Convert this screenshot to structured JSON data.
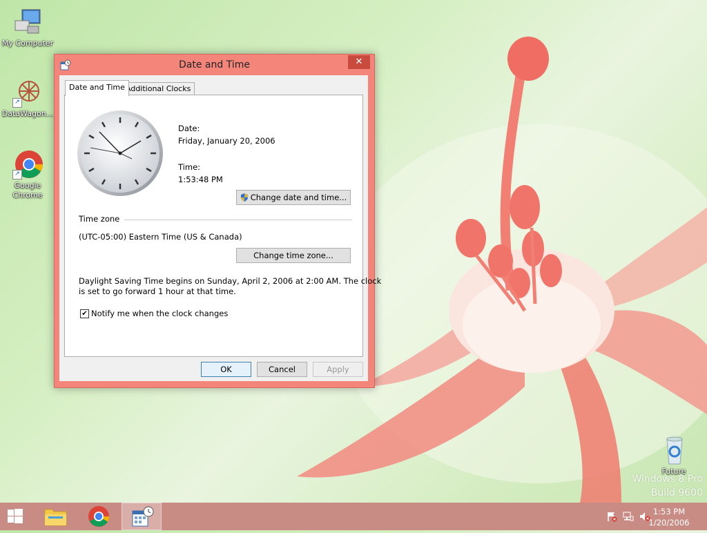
{
  "desktop": {
    "icons": [
      {
        "label": "My Computer"
      },
      {
        "label": "DataWagon..."
      },
      {
        "label_line1": "Google",
        "label_line2": "Chrome"
      },
      {
        "label": "Future"
      }
    ],
    "watermark": {
      "line1": "Windows 8 Pro",
      "line2": "Build 9600"
    }
  },
  "window": {
    "title": "Date and Time",
    "close_glyph": "✕",
    "tabs": [
      {
        "label": "Date and Time",
        "selected": true
      },
      {
        "label": "Additional Clocks",
        "selected": false
      }
    ],
    "date_label": "Date:",
    "date_value": "Friday, January 20, 2006",
    "time_label": "Time:",
    "time_value": "1:53:48 PM",
    "change_datetime_button": "Change date and time...",
    "timezone_header": "Time zone",
    "timezone_value": "(UTC-05:00) Eastern Time (US & Canada)",
    "change_timezone_button": "Change time zone...",
    "dst_line1": "Daylight Saving Time begins on Sunday, April 2, 2006 at 2:00 AM. The clock",
    "dst_line2": "is set to go forward 1 hour at that time.",
    "notify_checkbox": {
      "label": "Notify me when the clock changes",
      "checked": true
    },
    "buttons": {
      "ok": "OK",
      "cancel": "Cancel",
      "apply": "Apply"
    },
    "accent_color": "#f4857a"
  },
  "taskbar": {
    "items": [
      "start-button",
      "file-explorer",
      "google-chrome",
      "date-and-time"
    ],
    "clock_time": "1:53 PM",
    "clock_date": "1/20/2006",
    "color": "#c98c84"
  }
}
